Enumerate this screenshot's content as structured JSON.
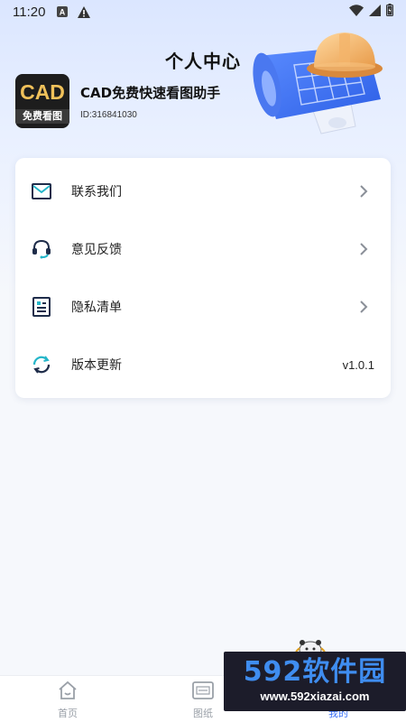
{
  "status_bar": {
    "time": "11:20",
    "left_icons": [
      "a-badge-icon",
      "warning-icon"
    ],
    "right_icons": [
      "wifi-icon",
      "signal-icon",
      "battery-icon"
    ]
  },
  "header": {
    "title": "个人中心"
  },
  "profile": {
    "logo_top": "CAD",
    "logo_bottom": "免费看图",
    "app_name": "CAD免费快速看图助手",
    "app_id": "ID:316841030"
  },
  "menu": {
    "items": [
      {
        "label": "联系我们",
        "icon": "mail-icon"
      },
      {
        "label": "意见反馈",
        "icon": "headset-icon"
      },
      {
        "label": "隐私清单",
        "icon": "document-list-icon"
      },
      {
        "label": "版本更新",
        "icon": "refresh-icon",
        "value": "v1.0.1"
      }
    ]
  },
  "tabs": [
    {
      "label": "首页",
      "icon": "home-icon"
    },
    {
      "label": "图纸",
      "icon": "cad-drawing-icon"
    },
    {
      "label": "我的",
      "icon": "profile-icon",
      "active": true
    }
  ],
  "watermark": {
    "line1": "592软件园",
    "line2": "www.592xiazai.com"
  },
  "colors": {
    "accent": "#3a6ff7",
    "icon_dark": "#1f2d4a",
    "icon_teal": "#25b6c9"
  }
}
